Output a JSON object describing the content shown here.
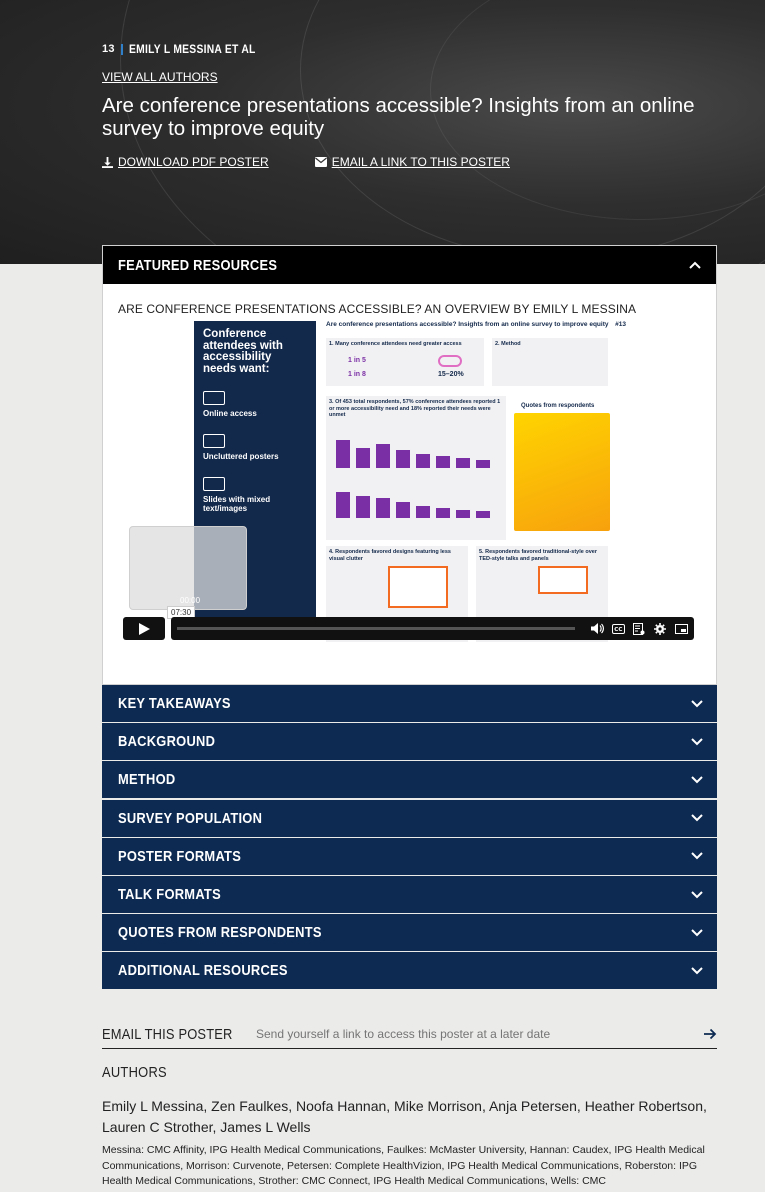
{
  "hero": {
    "poster_number": "13",
    "author_short": "EMILY L MESSINA ET AL",
    "view_authors": "VIEW ALL AUTHORS",
    "title": "Are conference presentations accessible? Insights from an online survey to improve equity",
    "download_label": "DOWNLOAD PDF POSTER",
    "email_link_label": "EMAIL A LINK TO THIS POSTER"
  },
  "featured": {
    "header": "FEATURED RESOURCES",
    "resource_title": "ARE CONFERENCE PRESENTATIONS ACCESSIBLE? AN OVERVIEW BY EMILY L MESSINA",
    "video": {
      "timecode": "07:30",
      "thumb_time": "00:00",
      "progress": 0.0,
      "poster_left": {
        "headline": "Conference attendees with accessibility needs want:",
        "items": [
          "Online access",
          "Uncluttered posters",
          "Slides with mixed text/images"
        ]
      },
      "poster_right": {
        "title": "Are conference presentations accessible? Insights from an online survey to improve equity",
        "number": "#13",
        "sec1": "1. Many conference attendees need greater access",
        "sec2": "2. Method",
        "sec3": "3. Of 453 total respondents, 57% conference attendees reported 1 or more accessibility need and 18% reported their needs were unmet",
        "quotes_head": "Quotes from respondents",
        "sec4": "4. Respondents favored designs featuring less visual clutter",
        "sec5": "5. Respondents favored traditional-style over TED-style talks and panels",
        "stat_a": "1 in 5",
        "stat_b": "1 in 8",
        "stat_c": "15–20%"
      }
    }
  },
  "accordion": [
    "KEY TAKEAWAYS",
    "BACKGROUND",
    "METHOD",
    "SURVEY POPULATION",
    "POSTER FORMATS",
    "TALK FORMATS",
    "QUOTES FROM RESPONDENTS",
    "ADDITIONAL RESOURCES"
  ],
  "email": {
    "label": "EMAIL THIS POSTER",
    "placeholder": "Send yourself a link to access this poster at a later date"
  },
  "authors": {
    "heading": "AUTHORS",
    "names": "Emily L Messina, Zen Faulkes, Noofa Hannan, Mike Morrison, Anja Petersen, Heather Robertson, Lauren C Strother, James L Wells",
    "affiliations": "Messina: CMC Affinity, IPG Health Medical Communications, Faulkes: McMaster University, Hannan: Caudex, IPG Health Medical Communications, Morrison: Curvenote, Petersen: Complete HealthVizion, IPG Health Medical Communications, Roberston: IPG Health Medical Communications, Strother: CMC Connect, IPG Health Medical Communications, Wells: CMC"
  },
  "colors": {
    "hero_bg": "#2e2e2e",
    "navy": "#0d2a52",
    "black_header": "#000000",
    "page_bg": "#ebebea",
    "accent_blue": "#2f80c9"
  }
}
